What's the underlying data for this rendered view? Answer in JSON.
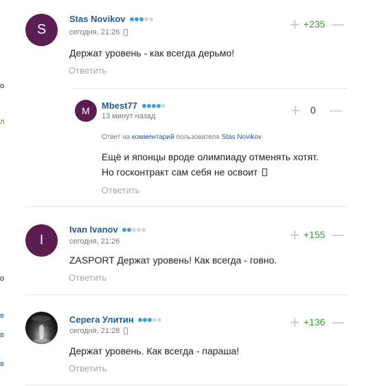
{
  "left_edge": [
    "о",
    "л",
    "о",
    "в",
    "в",
    "в"
  ],
  "comments": [
    {
      "author": "Stas Novikov",
      "avatar_letter": "S",
      "avatar_color": "#5c1e52",
      "meta": "сегодня, 21:26",
      "text": "Держат уровень - как всегда дерьмо!",
      "reply": "Ответить",
      "rating": "+235",
      "rank_dots": 3
    },
    {
      "author": "Mbest77",
      "avatar_letter": "M",
      "avatar_color": "#5c1e52",
      "meta": "13 минут назад",
      "reply_to": {
        "prefix": "Ответ на",
        "link": "комментарий",
        "middle": "пользователя",
        "user": "Stas Novikov"
      },
      "text_line1": "Ещё и японцы вроде олимпиаду отменять хотят.",
      "text_line2": "Но госконтракт сам себя не освоит ",
      "reply": "Ответить",
      "rating": "0",
      "rank_dots": 4
    },
    {
      "author": "Ivan Ivanov",
      "avatar_letter": "I",
      "avatar_color": "#5c1e52",
      "meta": "сегодня, 21:26",
      "text": "ZASPORT Держат уровень! Как всегда - говно.",
      "reply": "Ответить",
      "rating": "+155",
      "rank_dots": 2
    },
    {
      "author": "Серега Улитин",
      "meta": "сегодня, 21:28",
      "text": "Держат уровень. Как всегда - параша!",
      "reply": "Ответить",
      "rating": "+136",
      "rank_dots": 3
    }
  ],
  "colors": {
    "author": "#1c5c96",
    "rating_positive": "#2e9e2e",
    "reply": "#a8a8a8",
    "rank_on": "#3aa0df"
  },
  "icons": {
    "plus": "+",
    "minus": "—",
    "device": "phone-icon"
  }
}
